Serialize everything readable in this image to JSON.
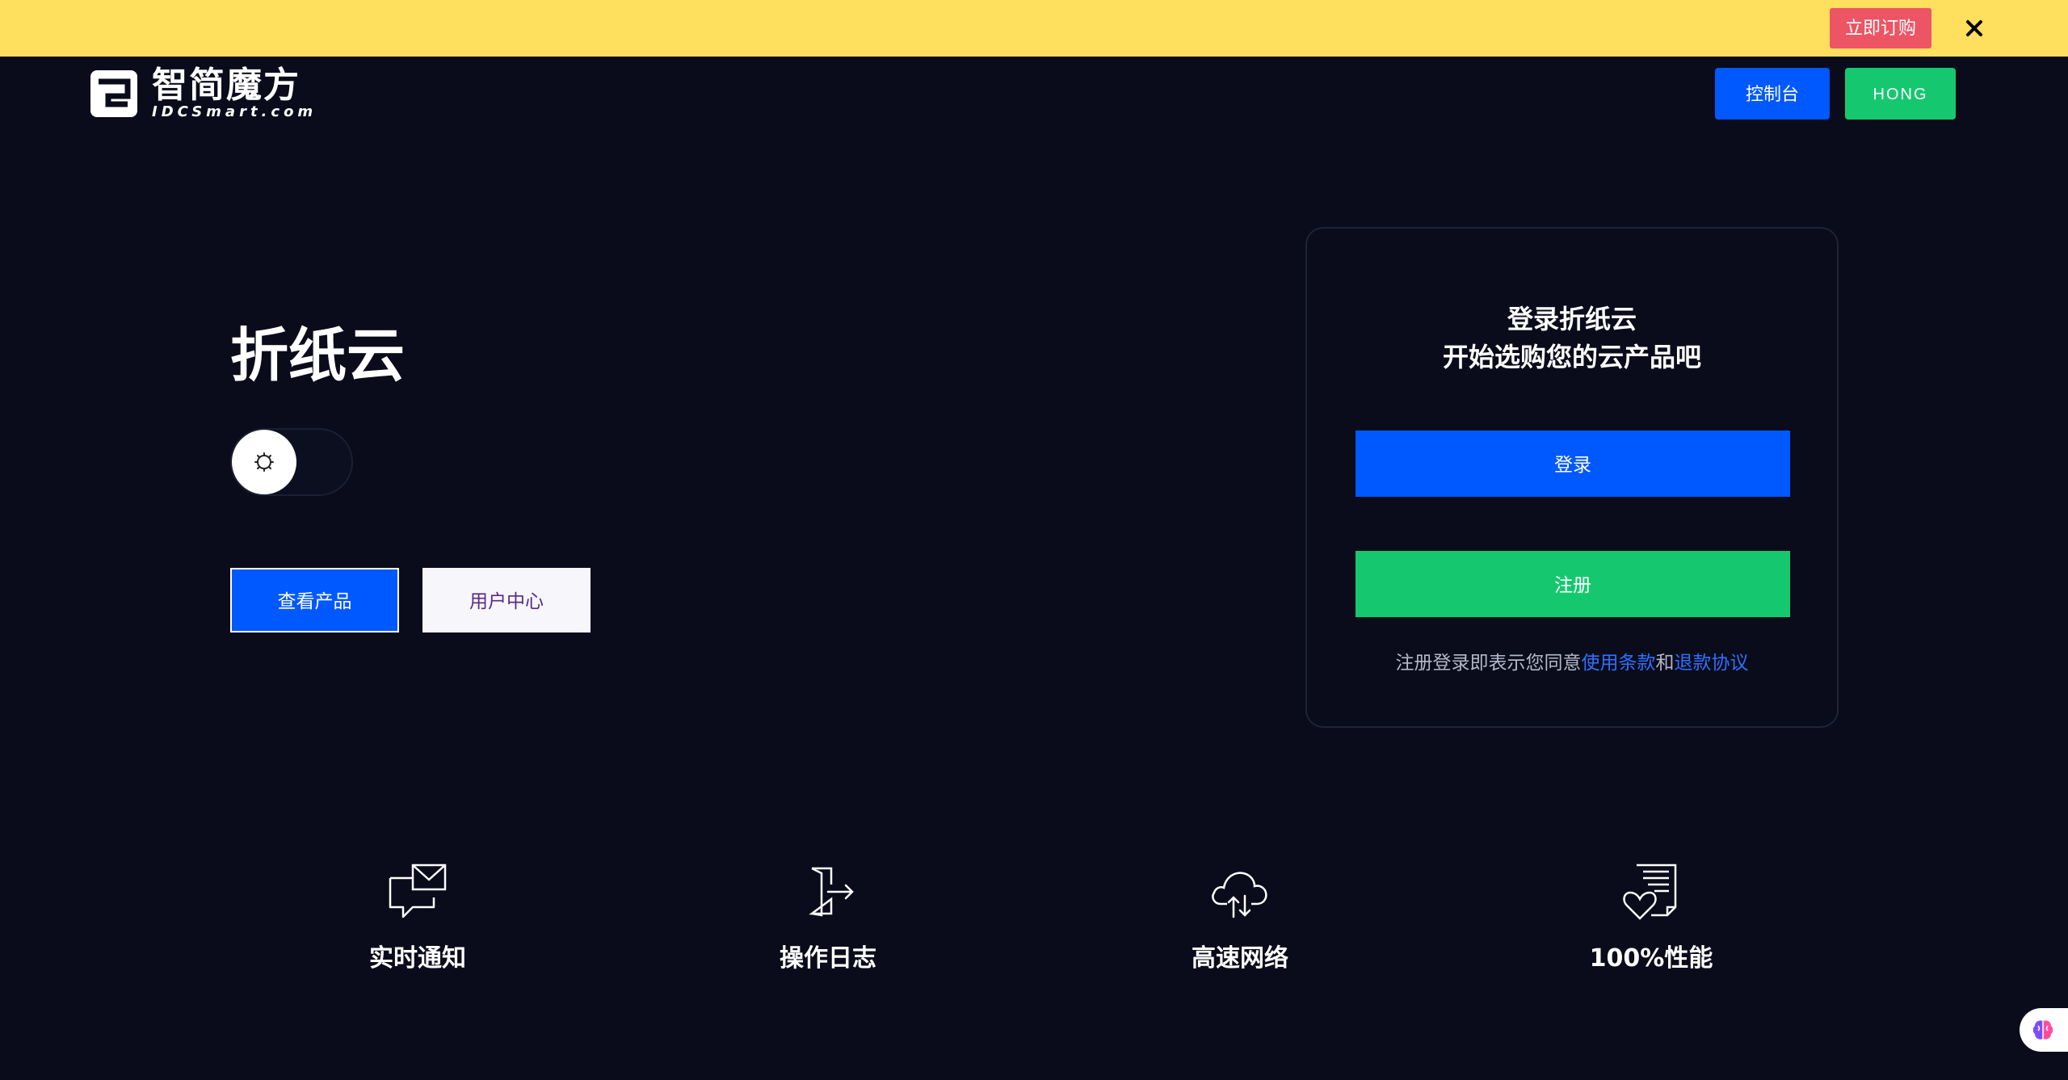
{
  "promo": {
    "order_label": "立即订购",
    "close_icon": "close-icon"
  },
  "header": {
    "logo_cn": "智简魔方",
    "logo_en": "IDCSmart.com",
    "console_label": "控制台",
    "user_label": "HONG"
  },
  "hero": {
    "title": "折纸云",
    "toggle_icon": "theme-toggle-icon",
    "view_products_label": "查看产品",
    "user_center_label": "用户中心"
  },
  "login_card": {
    "title": "登录折纸云",
    "subtitle": "开始选购您的云产品吧",
    "login_label": "登录",
    "register_label": "注册",
    "agreement_prefix": "注册登录即表示您同意",
    "terms_link": "使用条款",
    "agreement_and": "和",
    "refund_link": "退款协议"
  },
  "features": [
    {
      "icon": "notification-icon",
      "label": "实时通知"
    },
    {
      "icon": "logout-icon",
      "label": "操作日志"
    },
    {
      "icon": "cloud-transfer-icon",
      "label": "高速网络"
    },
    {
      "icon": "document-heart-icon",
      "label": "100%性能"
    }
  ],
  "colors": {
    "background": "#0a0c1b",
    "banner": "#ffdf5d",
    "order_red": "#ed5565",
    "primary_blue": "#0058ff",
    "success_green": "#15c86f",
    "link_blue": "#2f6fff"
  }
}
